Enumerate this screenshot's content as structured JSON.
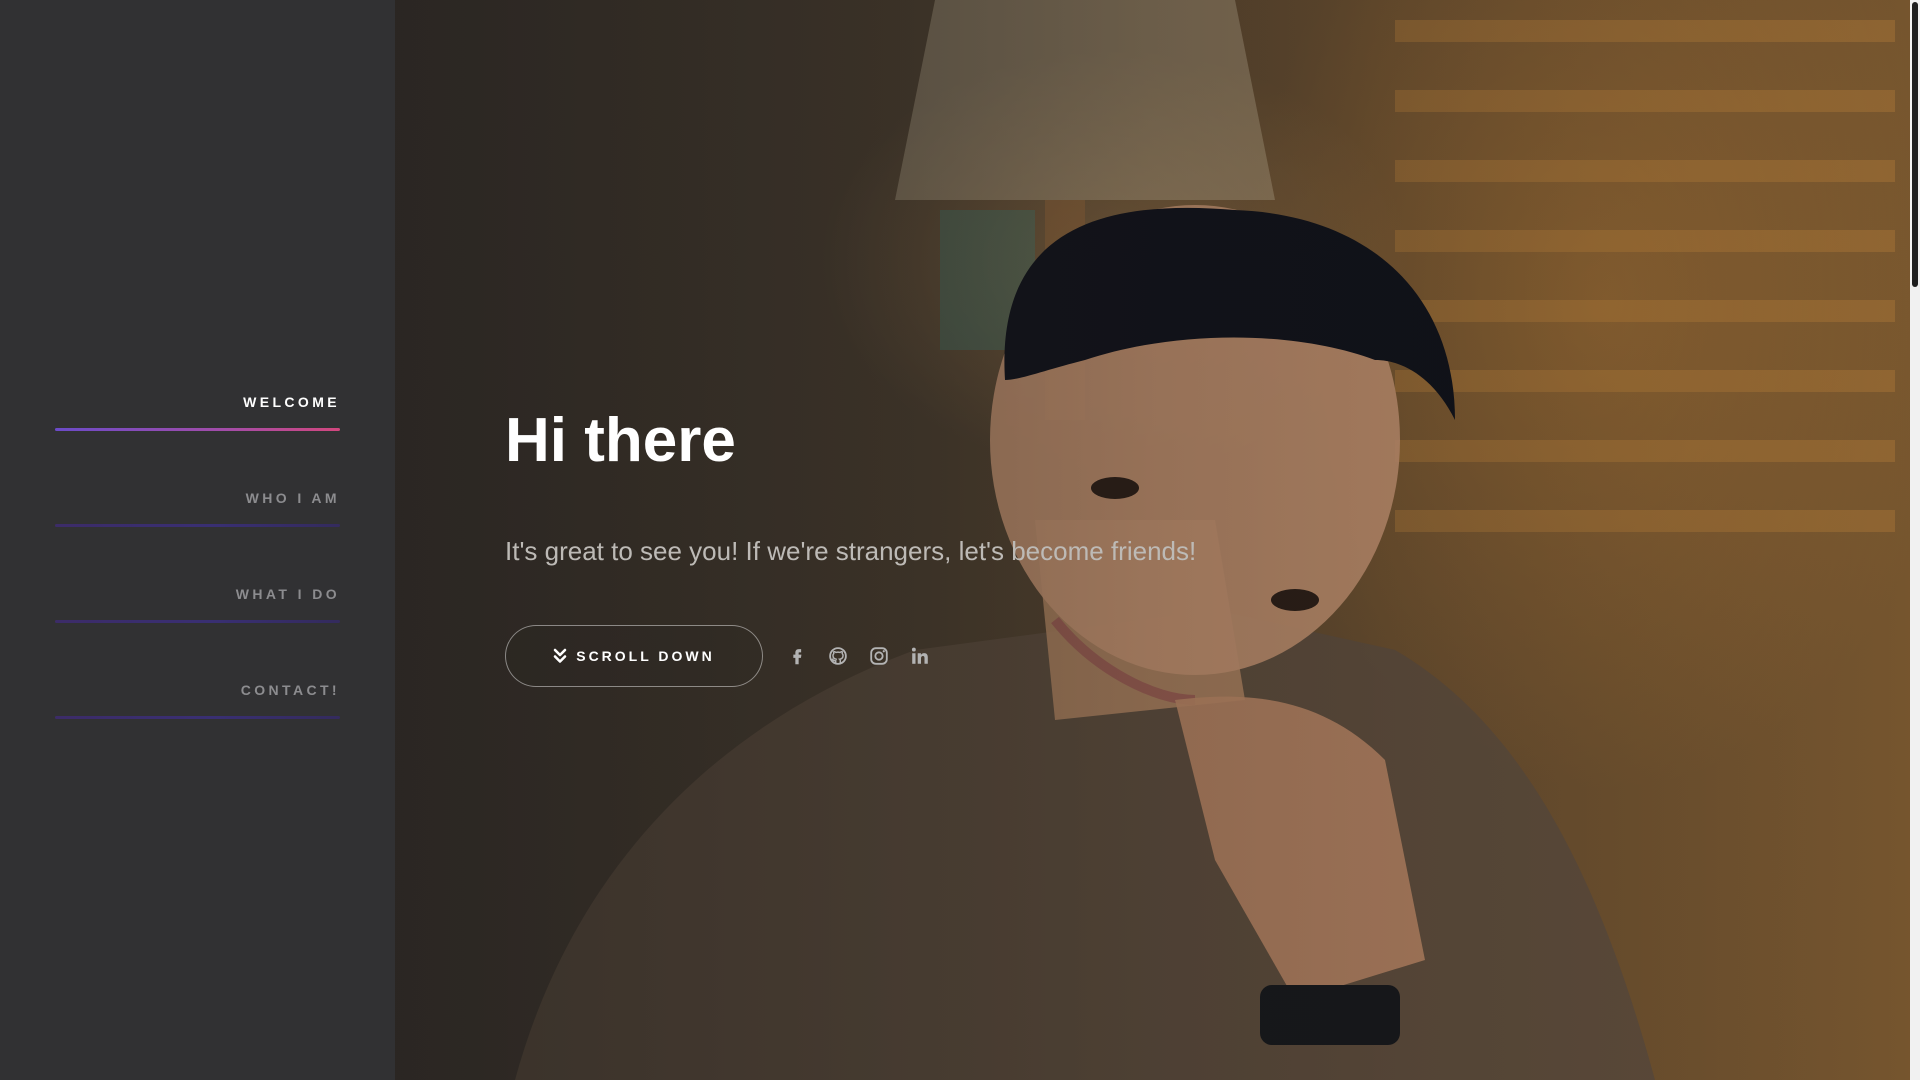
{
  "nav": {
    "items": [
      {
        "label": "WELCOME",
        "active": true
      },
      {
        "label": "WHO I AM",
        "active": false
      },
      {
        "label": "WHAT I DO",
        "active": false
      },
      {
        "label": "CONTACT!",
        "active": false
      }
    ]
  },
  "hero": {
    "title": "Hi there",
    "subtitle": "It's great to see you! If we're strangers, let's become friends!",
    "scroll_button_label": "SCROLL DOWN",
    "socials": [
      {
        "icon": "facebook-icon"
      },
      {
        "icon": "github-icon"
      },
      {
        "icon": "instagram-icon"
      },
      {
        "icon": "linkedin-icon"
      }
    ]
  },
  "colors": {
    "sidebar": "#313133",
    "accent_start": "#6b4bc8",
    "accent_end": "#d2477e",
    "nav_inactive": "#8c8c8f",
    "subtitle": "#bdbab6"
  }
}
